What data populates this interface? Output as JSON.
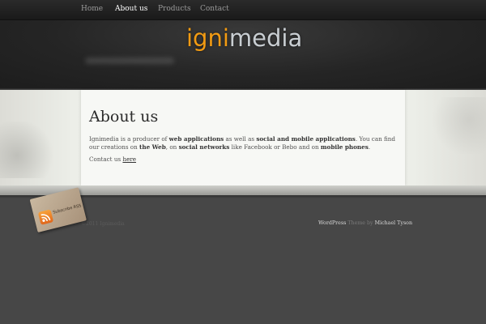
{
  "nav": {
    "items": [
      {
        "label": "Home"
      },
      {
        "label": "About us"
      },
      {
        "label": "Products"
      },
      {
        "label": "Contact"
      }
    ]
  },
  "logo": {
    "part_a": "igni",
    "part_b": "media"
  },
  "page": {
    "title": "About us",
    "p1": {
      "t1": "Ignimedia is a producer of ",
      "b1": "web applications",
      "t2": " as well as ",
      "b2": "social and mobile applications",
      "t3": ". You can find our creations on ",
      "b3": "the Web",
      "t4": ", on ",
      "b4": "social networks",
      "t5": " like Facebook or Bebo and on ",
      "b5": "mobile phones",
      "t6": "."
    },
    "p2": {
      "text": "Contact us ",
      "link": "here"
    }
  },
  "footer": {
    "copyright": "©2011 Ignimedia",
    "platform": "WordPress",
    "theme_by": "Theme by",
    "author": "Michael Tyson"
  },
  "rss": {
    "label": "Subscribe RSS",
    "icon": "rss-icon"
  },
  "colors": {
    "accent_orange": "#f29b13",
    "logo_grey": "#c9ced2",
    "footer_bg": "#474747"
  }
}
